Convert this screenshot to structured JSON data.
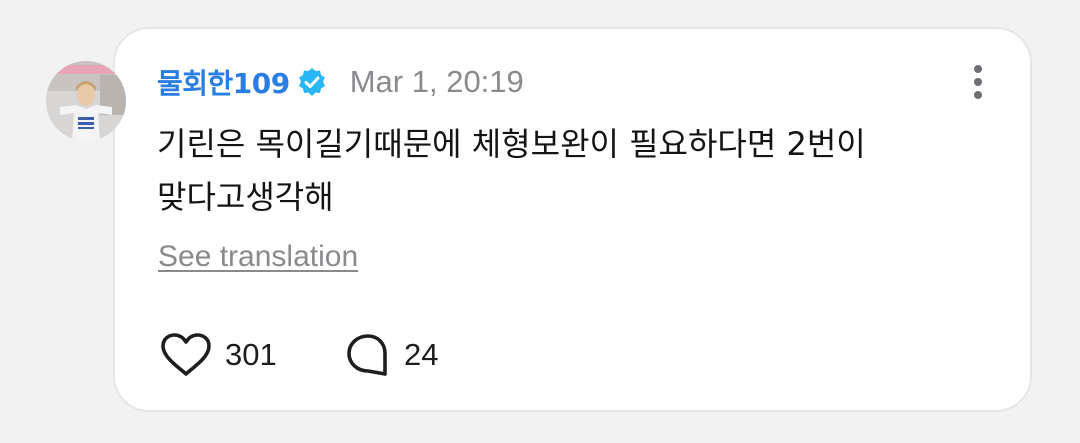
{
  "comment": {
    "author": "물회한109",
    "verified": true,
    "timestamp": "Mar 1, 20:19",
    "text": "기린은 목이길기때문에 체형보완이 필요하다면 2번이\n맞다고생각해",
    "see_translation_label": "See translation"
  },
  "actions": {
    "like_count": "301",
    "reply_count": "24"
  },
  "icons": {
    "like": "heart-icon",
    "reply": "speech-bubble-icon",
    "more": "vertical-ellipsis-icon",
    "verified": "verified-badge-icon"
  },
  "colors": {
    "author_name": "#2a7de1",
    "verified_badge": "#29b6f6",
    "muted_text": "#8a8a8e",
    "body_text": "#141414",
    "card_background": "#ffffff",
    "page_background": "#f2f2f3"
  }
}
